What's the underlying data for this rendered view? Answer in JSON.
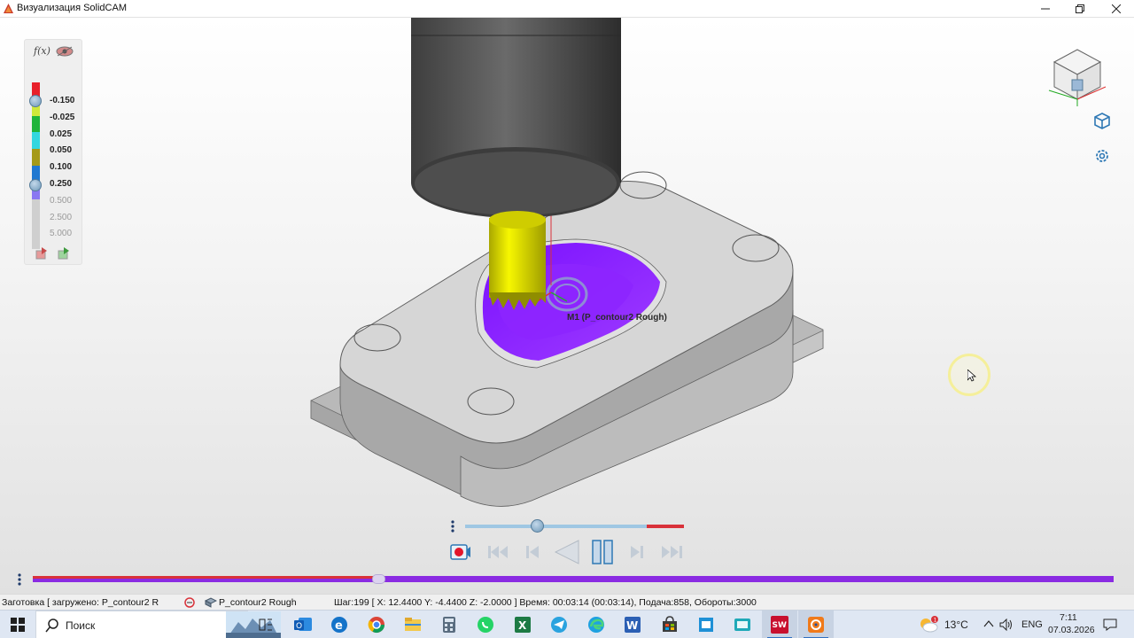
{
  "window": {
    "title": "Визуализация SolidCAM"
  },
  "legend": {
    "values": [
      "-0.150",
      "-0.025",
      "0.025",
      "0.050",
      "0.100",
      "0.250",
      "0.500",
      "2.500",
      "5.000"
    ],
    "colors": [
      "#e8202a",
      "#cfe93b",
      "#1fb43b",
      "#33d7df",
      "#a59a18",
      "#1f78d1",
      "#8a78f2",
      "#cfcfcf",
      "#cfcfcf",
      "#cfcfcf"
    ],
    "icons": [
      "fx-icon",
      "eye-icon",
      "stock-export-icon",
      "model-export-icon"
    ]
  },
  "viewport": {
    "toolpath_label": "M1 (P_contour2 Rough)",
    "view_cube_icon": "view-cube",
    "accent_color": "#8a2be2"
  },
  "playback": {
    "speed_level": 0.33,
    "buttons": [
      "record",
      "first",
      "prev-step",
      "play-back",
      "pause",
      "next-step",
      "last"
    ]
  },
  "progress": {
    "fraction": 0.32
  },
  "statusbar": {
    "stock": "Заготовка [ загружено:  P_contour2 R",
    "operation": "P_contour2 Rough",
    "info": "Шаг:199 [ X: 12.4400 Y: -4.4400 Z: -2.0000 ] Время: 00:03:14 (00:03:14), Подача:858, Обороты:3000"
  },
  "taskbar": {
    "search_placeholder": "Поиск",
    "weather": "13°C",
    "weather_badge": "1",
    "language": "ENG",
    "time": "7:11",
    "date": "07.03.2026",
    "apps": [
      "task-view",
      "outlook",
      "edge-legacy",
      "chrome",
      "file-explorer",
      "calculator",
      "whatsapp",
      "excel",
      "telegram",
      "edge",
      "word",
      "store",
      "sticky-notes",
      "screen-tool",
      "solidworks",
      "solidcam"
    ]
  }
}
